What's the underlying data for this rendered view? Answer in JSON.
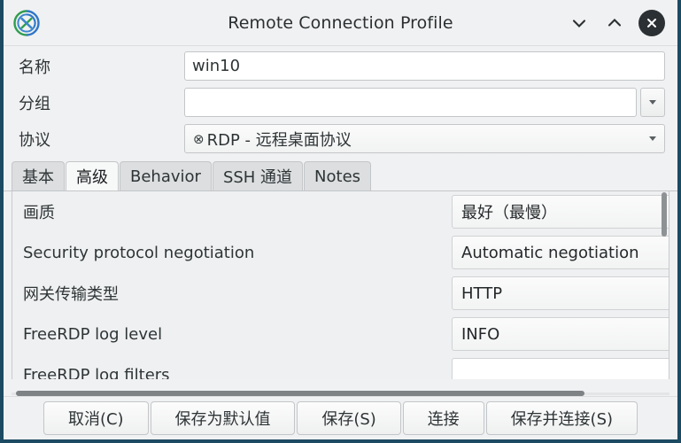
{
  "window": {
    "title": "Remote Connection Profile",
    "app_icon": "remmina-icon",
    "accent_border": "#1c4a63",
    "background": "#f0f1f2"
  },
  "titlebar_controls": [
    {
      "name": "minimize-button",
      "icon": "chevron-down-icon"
    },
    {
      "name": "maximize-button",
      "icon": "chevron-up-icon"
    },
    {
      "name": "close-button",
      "icon": "close-icon"
    }
  ],
  "form": {
    "name_label": "名称",
    "name_value": "win10",
    "name_placeholder": "",
    "group_label": "分组",
    "group_value": "",
    "group_placeholder": "",
    "protocol_label": "协议",
    "protocol_value": "RDP - 远程桌面协议",
    "protocol_glyph": "⊗"
  },
  "tabs": [
    {
      "label": "基本",
      "active": false
    },
    {
      "label": "高级",
      "active": true
    },
    {
      "label": "Behavior",
      "active": false
    },
    {
      "label": "SSH 通道",
      "active": false
    },
    {
      "label": "Notes",
      "active": false
    }
  ],
  "settings": [
    {
      "label": "画质",
      "value": "最好（最慢）",
      "blank": false
    },
    {
      "label": "Security protocol negotiation",
      "value": "Automatic negotiation",
      "blank": false
    },
    {
      "label": "网关传输类型",
      "value": "HTTP",
      "blank": false
    },
    {
      "label": "FreeRDP log level",
      "value": "INFO",
      "blank": false
    },
    {
      "label": "FreeRDP log filters",
      "value": "",
      "blank": true
    }
  ],
  "buttons": [
    {
      "label": "取消(C)",
      "name": "cancel-button"
    },
    {
      "label": "保存为默认值",
      "name": "save-as-default-button"
    },
    {
      "label": "保存(S)",
      "name": "save-button"
    },
    {
      "label": "连接",
      "name": "connect-button"
    },
    {
      "label": "保存并连接(S)",
      "name": "save-and-connect-button"
    }
  ]
}
